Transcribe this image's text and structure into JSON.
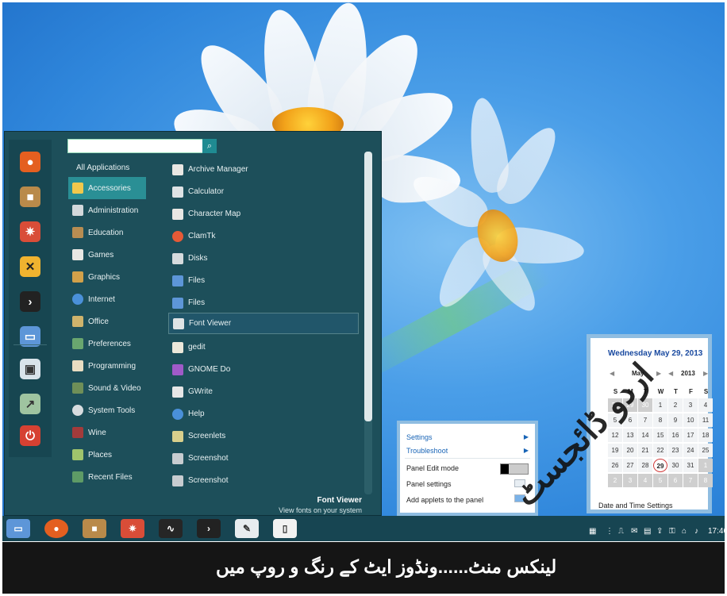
{
  "search": {
    "placeholder": "",
    "button_icon": "search-icon"
  },
  "categories_title": "All Applications",
  "categories": [
    {
      "label": "Accessories",
      "icon": "accessories-icon",
      "active": true
    },
    {
      "label": "Administration",
      "icon": "administration-icon"
    },
    {
      "label": "Education",
      "icon": "education-icon"
    },
    {
      "label": "Games",
      "icon": "games-icon"
    },
    {
      "label": "Graphics",
      "icon": "graphics-icon"
    },
    {
      "label": "Internet",
      "icon": "internet-icon"
    },
    {
      "label": "Office",
      "icon": "office-icon"
    },
    {
      "label": "Preferences",
      "icon": "preferences-icon"
    },
    {
      "label": "Programming",
      "icon": "programming-icon"
    },
    {
      "label": "Sound & Video",
      "icon": "sound-video-icon"
    },
    {
      "label": "System Tools",
      "icon": "system-tools-icon"
    },
    {
      "label": "Wine",
      "icon": "wine-icon"
    },
    {
      "label": "Places",
      "icon": "places-icon"
    },
    {
      "label": "Recent Files",
      "icon": "recent-files-icon"
    }
  ],
  "apps": [
    {
      "label": "Archive Manager",
      "icon": "archive-icon"
    },
    {
      "label": "Calculator",
      "icon": "calculator-icon"
    },
    {
      "label": "Character Map",
      "icon": "character-map-icon"
    },
    {
      "label": "ClamTk",
      "icon": "clamtk-icon"
    },
    {
      "label": "Disks",
      "icon": "disks-icon"
    },
    {
      "label": "Files",
      "icon": "folder-icon"
    },
    {
      "label": "Files",
      "icon": "folder-icon"
    },
    {
      "label": "Font Viewer",
      "icon": "font-viewer-icon",
      "hover": true
    },
    {
      "label": "gedit",
      "icon": "gedit-icon"
    },
    {
      "label": "GNOME Do",
      "icon": "gnome-do-icon"
    },
    {
      "label": "GWrite",
      "icon": "gwrite-icon"
    },
    {
      "label": "Help",
      "icon": "help-icon"
    },
    {
      "label": "Screenlets",
      "icon": "screenlets-icon"
    },
    {
      "label": "Screenshot",
      "icon": "screenshot-icon"
    },
    {
      "label": "Screenshot",
      "icon": "screenshot-icon"
    }
  ],
  "description": {
    "title": "Font Viewer",
    "text": "View fonts on your system"
  },
  "panel_menu": {
    "items": [
      {
        "label": "Settings",
        "type": "submenu"
      },
      {
        "label": "Troubleshoot",
        "type": "submenu"
      },
      {
        "label": "Panel Edit mode",
        "type": "toggle"
      },
      {
        "label": "Panel settings",
        "type": "action"
      },
      {
        "label": "Add applets to the panel",
        "type": "action"
      }
    ]
  },
  "calendar": {
    "date_title": "Wednesday May 29, 2013",
    "month": "May",
    "year": "2013",
    "weekdays": [
      "S",
      "M",
      "T",
      "W",
      "T",
      "F",
      "S"
    ],
    "weeks": [
      [
        "28",
        "29",
        "30",
        "1",
        "2",
        "3",
        "4"
      ],
      [
        "5",
        "6",
        "7",
        "8",
        "9",
        "10",
        "11"
      ],
      [
        "12",
        "13",
        "14",
        "15",
        "16",
        "17",
        "18"
      ],
      [
        "19",
        "20",
        "21",
        "22",
        "23",
        "24",
        "25"
      ],
      [
        "26",
        "27",
        "28",
        "29",
        "30",
        "31",
        "1"
      ],
      [
        "2",
        "3",
        "4",
        "5",
        "6",
        "7",
        "8"
      ]
    ],
    "settings_label": "Date and Time Settings"
  },
  "tray": {
    "time": "17:46"
  },
  "caption": {
    "text": "لینکس منٹ......ونڈوز ایٹ کے رنگ و روپ میں"
  },
  "watermark": {
    "text": "اردو ڈائجسٹ"
  },
  "colors": {
    "menu_bg": "#1d4f5a",
    "accent": "#2a8f95",
    "panel_bg": "#174552",
    "calendar_border": "#8fbde1",
    "link": "#1864b6"
  }
}
